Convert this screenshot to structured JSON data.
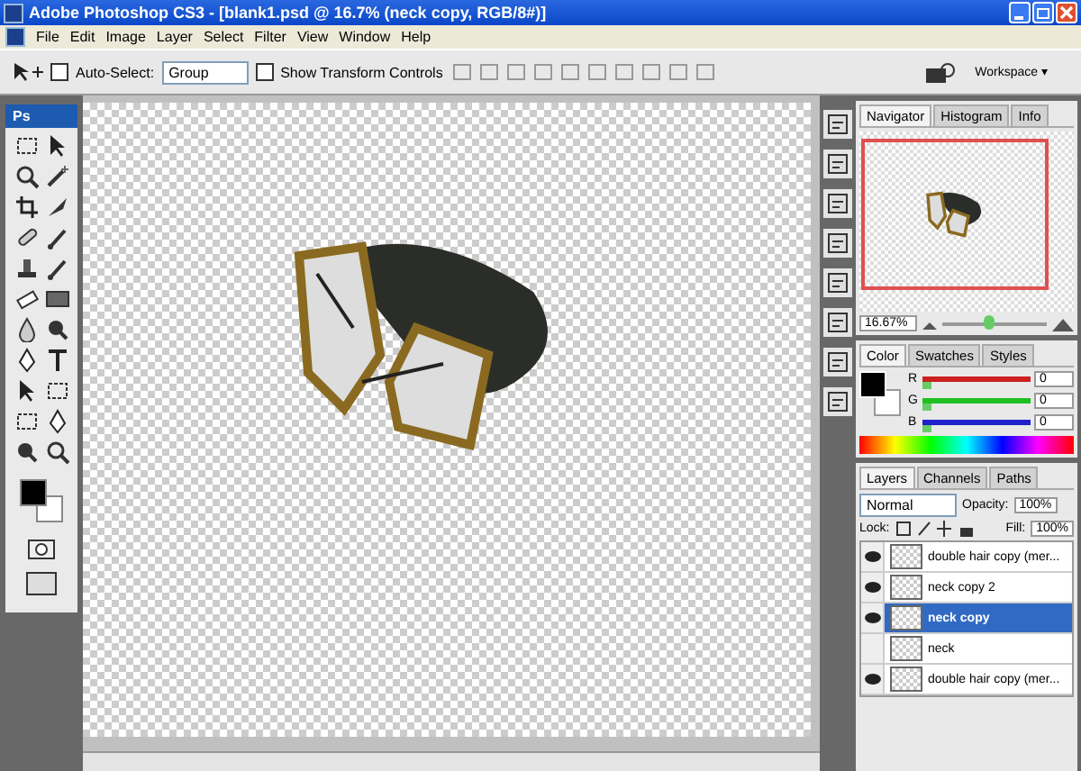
{
  "window": {
    "title": "Adobe Photoshop CS3 - [blank1.psd @ 16.7% (neck copy, RGB/8#)]"
  },
  "menu": [
    "File",
    "Edit",
    "Image",
    "Layer",
    "Select",
    "Filter",
    "View",
    "Window",
    "Help"
  ],
  "options_bar": {
    "auto_select": {
      "label": "Auto-Select:",
      "checked": false
    },
    "auto_select_target": "Group",
    "show_transform": {
      "label": "Show Transform Controls",
      "checked": false
    },
    "workspace": "Workspace ▾"
  },
  "toolbox": {
    "logo": "Ps"
  },
  "navigator": {
    "tabs": [
      {
        "label": "Navigator",
        "selected": true
      },
      {
        "label": "Histogram",
        "selected": false
      },
      {
        "label": "Info",
        "selected": false
      }
    ],
    "zoom": "16.67%",
    "zoom_slider": {
      "level": 0.4
    }
  },
  "color": {
    "tabs": [
      {
        "label": "Color",
        "selected": true
      },
      {
        "label": "Swatches",
        "selected": false
      },
      {
        "label": "Styles",
        "selected": false
      }
    ],
    "channels": [
      {
        "label": "R",
        "value": "0",
        "level": 0,
        "color": "#cc2020"
      },
      {
        "label": "G",
        "value": "0",
        "level": 0,
        "color": "#20c020"
      },
      {
        "label": "B",
        "value": "0",
        "level": 0,
        "color": "#2020cc"
      }
    ]
  },
  "layers": {
    "tabs": [
      {
        "label": "Layers",
        "selected": true
      },
      {
        "label": "Channels",
        "selected": false
      },
      {
        "label": "Paths",
        "selected": false
      }
    ],
    "blend_mode": "Normal",
    "opacity_label": "Opacity:",
    "opacity": "100%",
    "lock_label": "Lock:",
    "fill_label": "Fill:",
    "fill": "100%",
    "items": [
      {
        "name": "double hair copy (mer...",
        "visible": true,
        "selected": false
      },
      {
        "name": "neck copy 2",
        "visible": true,
        "selected": false
      },
      {
        "name": "neck copy",
        "visible": true,
        "selected": true
      },
      {
        "name": "neck",
        "visible": false,
        "selected": false
      },
      {
        "name": "double hair copy (mer...",
        "visible": true,
        "selected": false
      }
    ]
  }
}
